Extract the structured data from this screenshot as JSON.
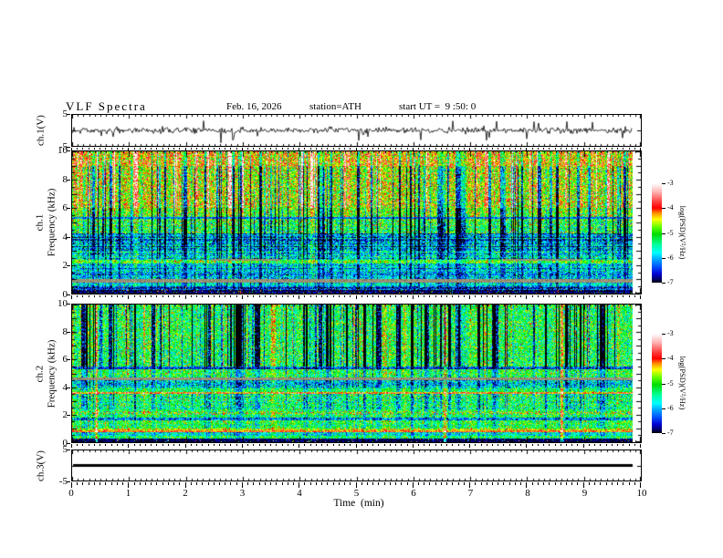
{
  "header": {
    "title": "VLF Spectra",
    "date": "Feb. 16, 2026",
    "station": "station=ATH",
    "start_ut": "start UT =  9 :50: 0"
  },
  "axes": {
    "time": {
      "label": "Time  (min)",
      "tick_labels": [
        "0",
        "1",
        "2",
        "3",
        "4",
        "5",
        "6",
        "7",
        "8",
        "9",
        "10"
      ]
    },
    "freq": {
      "tick_labels": [
        "10",
        "8",
        "6",
        "4",
        "2",
        "0"
      ]
    },
    "volts": {
      "tick_labels": [
        "5",
        "-5"
      ]
    }
  },
  "panels": {
    "wave1": {
      "ylabel": "ch.1(V)"
    },
    "spec1": {
      "ylabel_ch": "ch.1",
      "ylabel_unit": "Frequency (kHz)"
    },
    "spec2": {
      "ylabel_ch": "ch.2",
      "ylabel_unit": "Frequency (kHz)"
    },
    "wave3": {
      "ylabel": "ch.3(V)"
    }
  },
  "colorbar": {
    "label": "log(PSD)(V²/Hz)",
    "tick_labels": [
      "-3",
      "-4",
      "-5",
      "-6",
      "-7"
    ],
    "tick_values": [
      -3,
      -4,
      -5,
      -6,
      -7
    ]
  },
  "chart_data": {
    "type": "heatmap",
    "title": "VLF Spectra",
    "x_axis": {
      "label": "Time  (min)",
      "range_min": [
        0,
        10
      ],
      "major_tick_step": 1,
      "minor_tick_step": 0.1,
      "data_end_min": 9.85
    },
    "freq_axis": {
      "range_khz": [
        0,
        10
      ],
      "major_tick_khz": 2,
      "minor_tick_khz": 0.5
    },
    "z_axis": {
      "label": "log(PSD)(V²/Hz)",
      "range": [
        -7,
        -3
      ]
    },
    "colormap_stops": [
      [
        -7.0,
        "#000000"
      ],
      [
        -6.88,
        "#000060"
      ],
      [
        -6.65,
        "#0000d2"
      ],
      [
        -6.35,
        "#0055ff"
      ],
      [
        -6.05,
        "#00aaff"
      ],
      [
        -5.8,
        "#00ffff"
      ],
      [
        -5.45,
        "#00ff96"
      ],
      [
        -5.05,
        "#00dc00"
      ],
      [
        -4.75,
        "#66ff00"
      ],
      [
        -4.45,
        "#ffff00"
      ],
      [
        -4.2,
        "#ff8c00"
      ],
      [
        -4.0,
        "#ff0000"
      ],
      [
        -3.75,
        "#ff3c3c"
      ],
      [
        -3.35,
        "#ffb4b4"
      ],
      [
        -3.0,
        "#ffffff"
      ]
    ],
    "panels": [
      {
        "id": "wave1",
        "kind": "line",
        "channel": "ch.1",
        "units": "V",
        "ylim": [
          -5,
          5
        ],
        "signal": {
          "mean": 0,
          "noise_sigma": 0.5,
          "spike_prob": 0.033,
          "spike_amp_max": 4.8
        }
      },
      {
        "id": "spec1",
        "kind": "spectrogram",
        "channel": "ch.1",
        "ylim_khz": [
          0,
          10
        ],
        "bands": [
          {
            "f0": 2.3,
            "f1": 2.45,
            "gray": true,
            "segments": [
              [
                2.45,
                3.65
              ],
              [
                7.55,
                8.95
              ]
            ]
          },
          {
            "f0": 9.0,
            "f1": 10.0,
            "base": -4.25,
            "pn": 0.5,
            "rn": 0.12,
            "sp": 0.95,
            "sn": 0.7
          },
          {
            "f0": 6.0,
            "f1": 9.0,
            "base": -4.6,
            "pn": 0.5,
            "rn": 0.15,
            "sp": 0.95,
            "sn": 1.25
          },
          {
            "f0": 5.4,
            "f1": 6.0,
            "base": -4.9,
            "pn": 0.5,
            "rn": 0.12,
            "sp": 0.5,
            "sn": 1.5
          },
          {
            "f0": 5.25,
            "f1": 5.4,
            "base": -6.3,
            "pn": 0.3,
            "rn": 0.1,
            "sp": 0.2,
            "sn": 0.3
          },
          {
            "f0": 4.2,
            "f1": 5.25,
            "base": -5.1,
            "pn": 0.55,
            "rn": 0.2,
            "sp": 0.3,
            "sn": 1.8
          },
          {
            "f0": 3.0,
            "f1": 4.2,
            "base": -6.0,
            "pn": 0.5,
            "rn": 0.55,
            "sp": 0.35,
            "sn": 0.8
          },
          {
            "f0": 2.35,
            "f1": 3.0,
            "base": -5.7,
            "pn": 0.5,
            "rn": 0.5,
            "sp": 0.3,
            "sn": 0.7
          },
          {
            "f0": 2.1,
            "f1": 2.35,
            "base": -4.95,
            "pn": 0.4,
            "rn": 0.2,
            "sp": 0.3,
            "sn": 0.5
          },
          {
            "f0": 1.05,
            "f1": 2.1,
            "base": -5.9,
            "pn": 0.45,
            "rn": 0.45,
            "sp": 0.25,
            "sn": 0.5
          },
          {
            "f0": 0.8,
            "f1": 1.05,
            "gray": true
          },
          {
            "f0": 0.5,
            "f1": 0.8,
            "base": -5.8,
            "pn": 0.4,
            "rn": 0.3,
            "sp": 0.2,
            "sn": 0.5
          },
          {
            "f0": 0.28,
            "f1": 0.5,
            "base": -6.5,
            "pn": 0.4,
            "rn": 0.3,
            "sp": 0.1,
            "sn": 0.2,
            "speckle": 0.03
          },
          {
            "f0": 0.0,
            "f1": 0.28,
            "base": -6.85,
            "pn": 0.15,
            "rn": 0.1,
            "sp": 0,
            "sn": 0,
            "speckle": 0.07
          }
        ]
      },
      {
        "id": "spec2",
        "kind": "spectrogram",
        "channel": "ch.2",
        "ylim_khz": [
          0,
          10
        ],
        "hot_columns_min": [
          0.42,
          6.55,
          8.6
        ],
        "bands": [
          {
            "f0": 5.5,
            "f1": 10.0,
            "base": -5.15,
            "pn": 0.5,
            "rn": 0.12,
            "sp": 0.5,
            "sn": 1.6
          },
          {
            "f0": 5.3,
            "f1": 5.5,
            "base": -6.35,
            "pn": 0.4,
            "rn": 0.15,
            "sp": 0.2,
            "sn": 0.3
          },
          {
            "f0": 4.7,
            "f1": 5.3,
            "base": -5.1,
            "pn": 0.45,
            "rn": 0.15,
            "sp": 0.3,
            "sn": 0.6
          },
          {
            "f0": 4.5,
            "f1": 4.7,
            "gray": true
          },
          {
            "f0": 3.9,
            "f1": 4.5,
            "base": -5.7,
            "pn": 0.5,
            "rn": 0.3,
            "sp": 0.2,
            "sn": 0.5
          },
          {
            "f0": 3.66,
            "f1": 3.9,
            "base": -5.2,
            "pn": 0.4,
            "rn": 0.15,
            "sp": 0.2,
            "sn": 0.4
          },
          {
            "f0": 3.5,
            "f1": 3.66,
            "base": -4.1,
            "pn": 0.45,
            "rn": 0.1,
            "sp": 0.2,
            "sn": 0.2
          },
          {
            "f0": 2.4,
            "f1": 3.5,
            "base": -5.35,
            "pn": 0.5,
            "rn": 0.25,
            "sp": 0.25,
            "sn": 0.6
          },
          {
            "f0": 2.25,
            "f1": 2.4,
            "base": -5.1,
            "pn": 0.4,
            "rn": 0.15,
            "sp": 0.2,
            "sn": 0.4
          },
          {
            "f0": 2.0,
            "f1": 2.25,
            "base": -4.85,
            "pn": 0.65,
            "rn": 0.2,
            "sp": 0.4,
            "sn": 0.3
          },
          {
            "f0": 1.78,
            "f1": 2.0,
            "base": -5.3,
            "pn": 0.4,
            "rn": 0.2,
            "sp": 0.2,
            "sn": 0.4
          },
          {
            "f0": 1.6,
            "f1": 1.78,
            "base": -6.3,
            "pn": 0.45,
            "rn": 0.2,
            "sp": 0.2,
            "sn": 0.2
          },
          {
            "f0": 1.0,
            "f1": 1.6,
            "base": -5.1,
            "pn": 0.45,
            "rn": 0.25,
            "sp": 0.25,
            "sn": 0.4
          },
          {
            "f0": 0.85,
            "f1": 1.0,
            "base": -4.45,
            "pn": 0.35,
            "rn": 0.1,
            "sp": 0.2,
            "sn": 0.2
          },
          {
            "f0": 0.7,
            "f1": 0.85,
            "base": -4.05,
            "pn": 0.3,
            "rn": 0.1,
            "sp": 0.15,
            "sn": 0.15
          },
          {
            "f0": 0.45,
            "f1": 0.7,
            "base": -5.6,
            "pn": 0.4,
            "rn": 0.2,
            "sp": 0.2,
            "sn": 0.3
          },
          {
            "f0": 0.25,
            "f1": 0.45,
            "base": -5.15,
            "pn": 0.4,
            "rn": 0.2,
            "sp": 0.2,
            "sn": 0.3
          },
          {
            "f0": 0.0,
            "f1": 0.25,
            "base": -6.85,
            "pn": 0.15,
            "rn": 0.1,
            "sp": 0,
            "sn": 0,
            "speckle": 0.05
          }
        ]
      },
      {
        "id": "wave3",
        "kind": "line",
        "channel": "ch.3",
        "units": "V",
        "ylim": [
          -5,
          5
        ],
        "signal": {
          "constant": 0,
          "line_thickness_v": 0.8
        }
      }
    ]
  }
}
